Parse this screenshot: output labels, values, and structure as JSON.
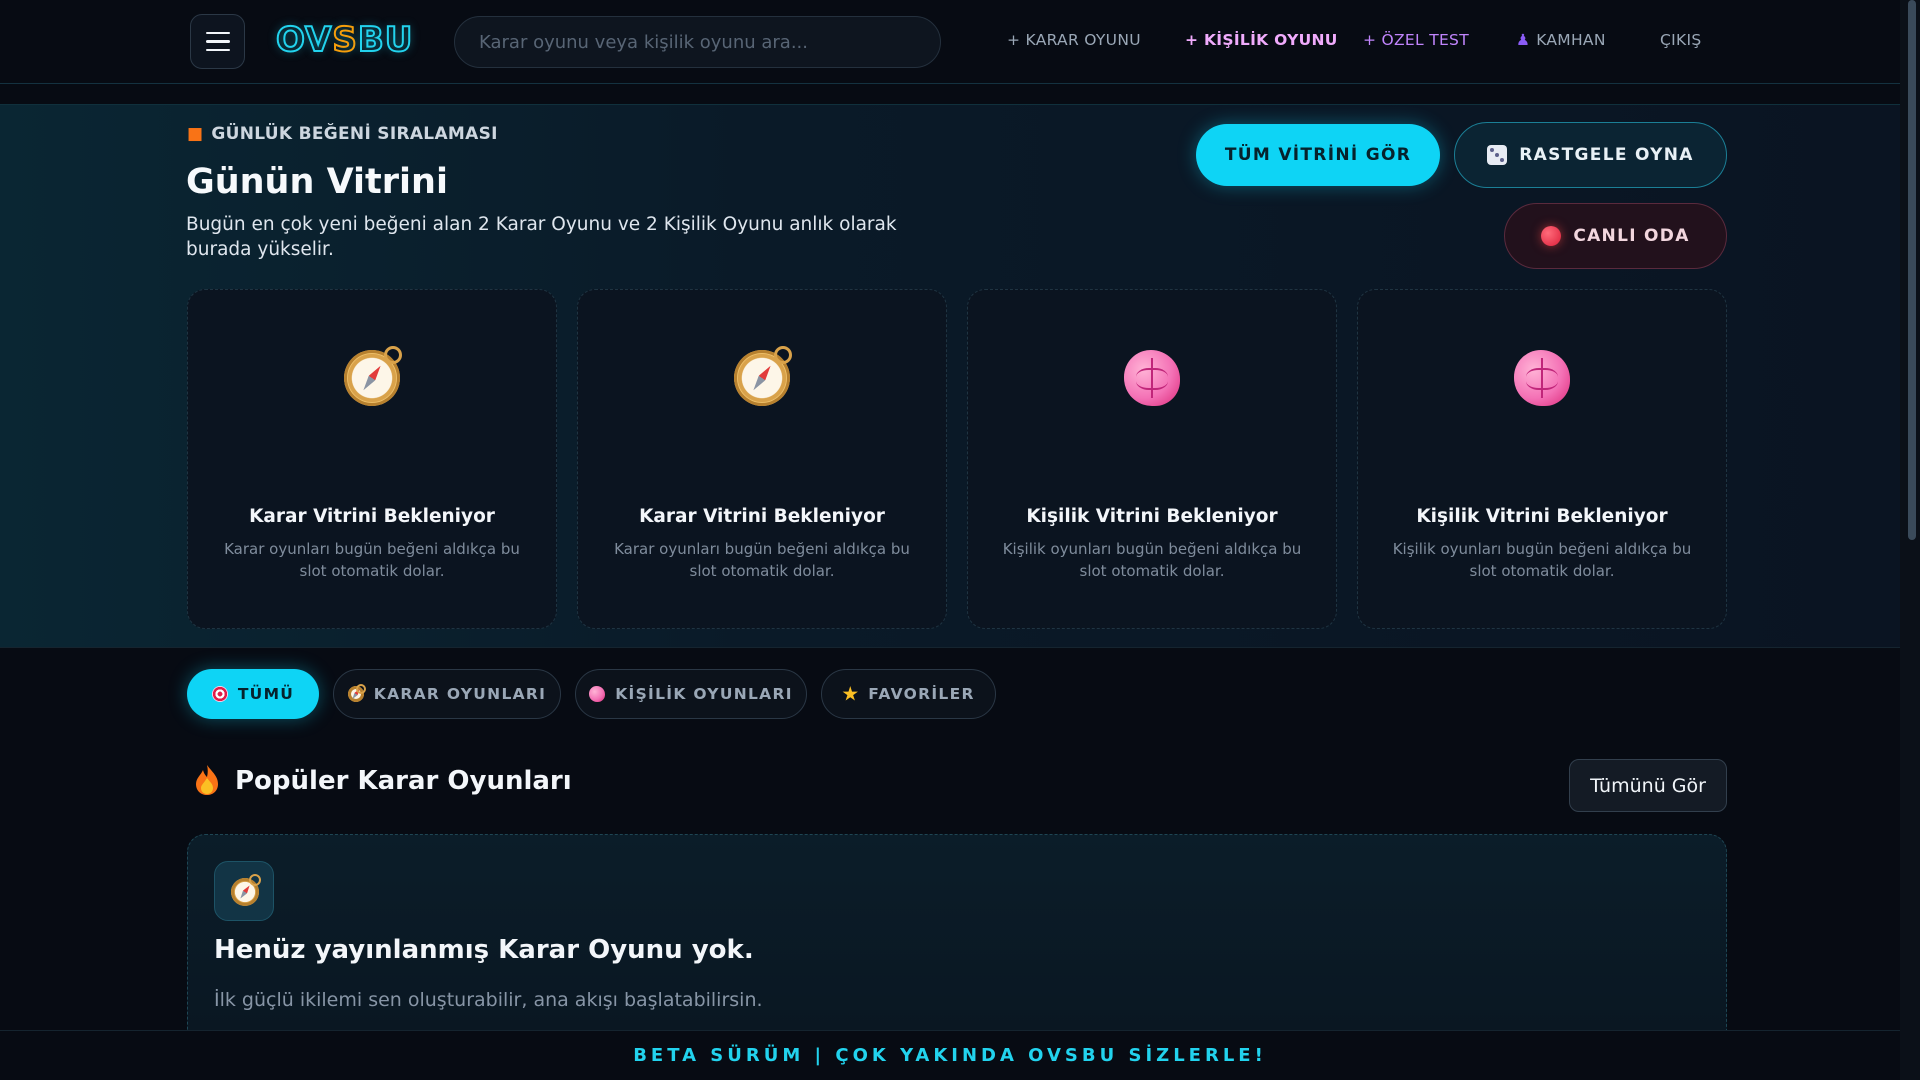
{
  "nav": {
    "search_placeholder": "Karar oyunu veya kişilik oyunu ara...",
    "links": [
      "+ KARAR OYUNU",
      "+ KİŞİLİK OYUNU",
      "+ ÖZEL TEST",
      "KAMHAN",
      "ÇIKIŞ"
    ]
  },
  "logo": {
    "part1": "OV",
    "part2": "S",
    "part3": "BU"
  },
  "hero": {
    "eyebrow": "GÜNLÜK BEĞENİ SIRALAMASI",
    "title": "Günün Vitrini",
    "subtitle": "Bugün en çok yeni beğeni alan 2 Karar Oyunu ve 2 Kişilik Oyunu anlık olarak burada yükselir.",
    "btn_all": "TÜM VİTRİNİ GÖR",
    "btn_random": "RASTGELE OYNA",
    "btn_live": "CANLI ODA"
  },
  "cards": [
    {
      "icon": "compass-icon",
      "title": "Karar Vitrini Bekleniyor",
      "desc": "Karar oyunları bugün beğeni aldıkça bu slot otomatik dolar."
    },
    {
      "icon": "compass-icon",
      "title": "Karar Vitrini Bekleniyor",
      "desc": "Karar oyunları bugün beğeni aldıkça bu slot otomatik dolar."
    },
    {
      "icon": "brain-icon",
      "title": "Kişilik Vitrini Bekleniyor",
      "desc": "Kişilik oyunları bugün beğeni aldıkça bu slot otomatik dolar."
    },
    {
      "icon": "brain-icon",
      "title": "Kişilik Vitrini Bekleniyor",
      "desc": "Kişilik oyunları bugün beğeni aldıkça bu slot otomatik dolar."
    }
  ],
  "tabs": [
    "TÜMÜ",
    "KARAR OYUNLARI",
    "KİŞİLİK OYUNLARI",
    "FAVORİLER"
  ],
  "section": {
    "title": "Popüler Karar Oyunları",
    "see_all": "Tümünü Gör",
    "empty_title": "Henüz yayınlanmış Karar Oyunu yok.",
    "empty_desc": "İlk güçlü ikilemi sen oluşturabilir, ana akışı başlatabilirsin."
  },
  "beta": "BETA SÜRÜM | ÇOK YAKINDA OVSBU SİZLERLE!",
  "colors": {
    "accent": "#0ed4f5",
    "background": "#070b13",
    "live": "#dc1f3a",
    "personality": "#f472b6"
  }
}
